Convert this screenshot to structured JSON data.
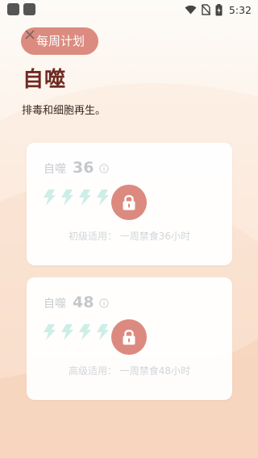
{
  "status_bar": {
    "time": "5:32",
    "icons": [
      "app-square-icon",
      "app-square-icon",
      "wifi-icon",
      "no-sim-icon",
      "battery-charging-icon"
    ]
  },
  "header": {
    "close_icon": "close-icon",
    "plan_button_label": "每周计划",
    "title": "自噬",
    "subtitle": "排毒和细胞再生。"
  },
  "plans": [
    {
      "name": "自噬",
      "hours": "36",
      "level_label": "初级适用：",
      "description": "一周禁食36小时",
      "locked": true
    },
    {
      "name": "自噬",
      "hours": "48",
      "level_label": "高级适用：",
      "description": "一周禁食48小时",
      "locked": true
    }
  ],
  "colors": {
    "accent": "#dc8b80",
    "title": "#6e2a22",
    "bolt": "#cdeee6",
    "card_text_muted": "#c8ccd0"
  }
}
